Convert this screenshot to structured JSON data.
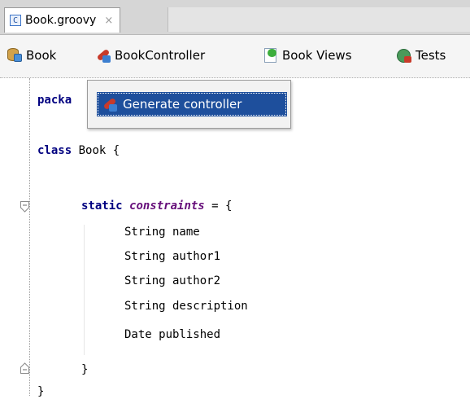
{
  "tabbar": {
    "tabs": [
      {
        "label": "Book.groovy",
        "icon": "groovy-class-icon",
        "icon_glyph": "C",
        "close_glyph": "×"
      }
    ]
  },
  "navbar": {
    "items": [
      {
        "label": "Book",
        "icon": "domain-class-icon"
      },
      {
        "label": "BookController",
        "icon": "controller-icon"
      },
      {
        "label": "Book Views",
        "icon": "views-icon"
      },
      {
        "label": "Tests",
        "icon": "tests-icon"
      }
    ]
  },
  "popup": {
    "item_label": "Generate controller",
    "item_icon": "controller-icon"
  },
  "code": {
    "package_partial": "packa",
    "class_keyword": "class",
    "class_rest": " Book {",
    "static_keyword": "static",
    "field_name": "constraints",
    "assign_rest": " = {",
    "lines": [
      "String name",
      "String author1",
      "String author2",
      "String description",
      "Date published"
    ],
    "inner_close": "}",
    "outer_close": "}"
  },
  "colors": {
    "keyword": "#000080",
    "field": "#660e7a",
    "selection": "#1e4f9c"
  }
}
